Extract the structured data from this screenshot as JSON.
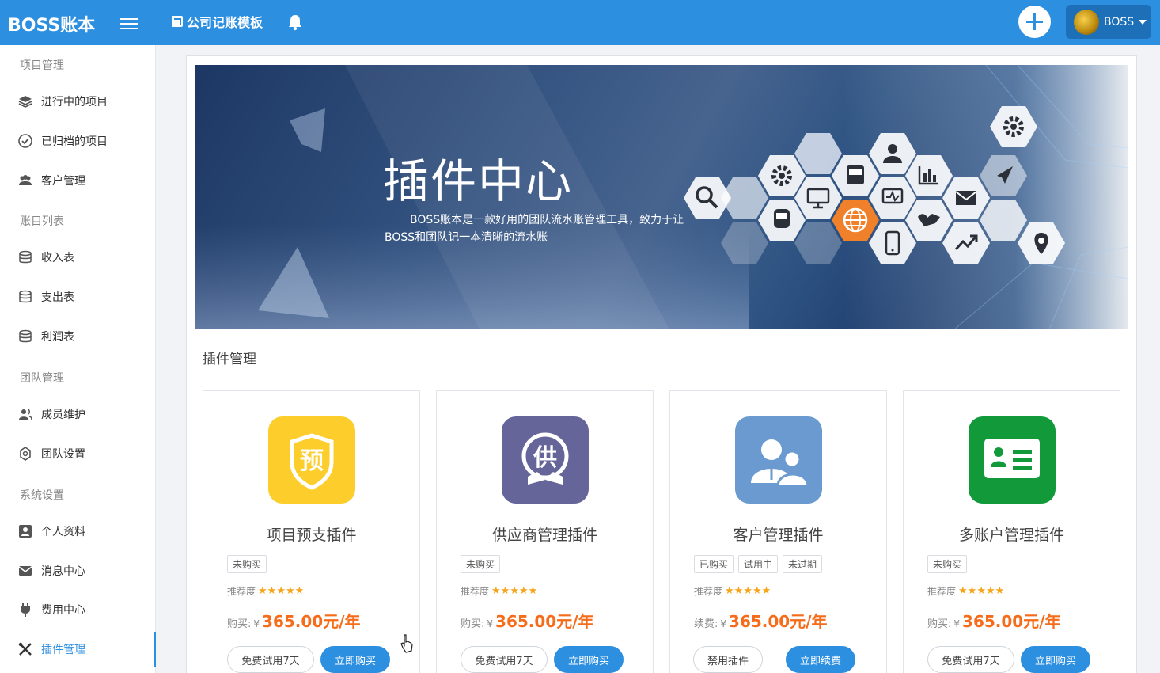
{
  "app": {
    "logo": "BOSS账本",
    "template_link": "公司记账模板",
    "user_name": "BOSS"
  },
  "sidebar": {
    "sections": [
      {
        "title": "项目管理",
        "items": [
          {
            "label": "进行中的项目",
            "icon": "layers-icon"
          },
          {
            "label": "已归档的项目",
            "icon": "check-circle-icon"
          },
          {
            "label": "客户管理",
            "icon": "users-icon"
          }
        ]
      },
      {
        "title": "账目列表",
        "items": [
          {
            "label": "收入表",
            "icon": "database-icon"
          },
          {
            "label": "支出表",
            "icon": "database-icon"
          },
          {
            "label": "利润表",
            "icon": "database-icon"
          }
        ]
      },
      {
        "title": "团队管理",
        "items": [
          {
            "label": "成员维护",
            "icon": "user-group-icon"
          },
          {
            "label": "团队设置",
            "icon": "gear-outline-icon"
          }
        ]
      },
      {
        "title": "系统设置",
        "items": [
          {
            "label": "个人资料",
            "icon": "profile-icon"
          },
          {
            "label": "消息中心",
            "icon": "mail-icon"
          },
          {
            "label": "费用中心",
            "icon": "plug-icon"
          },
          {
            "label": "插件管理",
            "icon": "tools-icon",
            "active": true
          }
        ]
      }
    ]
  },
  "banner": {
    "title": "插件中心",
    "desc": "BOSS账本是一款好用的团队流水账管理工具，致力于让BOSS和团队记一本清晰的流水账"
  },
  "plugins_section": {
    "title": "插件管理"
  },
  "plugins": [
    {
      "name": "项目预支插件",
      "icon_color": "#fdcd2c",
      "icon_glyph": "预",
      "tags": [
        "未购买"
      ],
      "rate_label": "推荐度",
      "stars": "★★★★★",
      "price_label": "购买:",
      "currency": "¥",
      "price": "365.00元/年",
      "btn_left": "免费试用7天",
      "btn_right": "立即购买"
    },
    {
      "name": "供应商管理插件",
      "icon_color": "#66659a",
      "icon_glyph": "供",
      "tags": [
        "未购买"
      ],
      "rate_label": "推荐度",
      "stars": "★★★★★",
      "price_label": "购买:",
      "currency": "¥",
      "price": "365.00元/年",
      "btn_left": "免费试用7天",
      "btn_right": "立即购买"
    },
    {
      "name": "客户管理插件",
      "icon_color": "#6a9ad0",
      "icon_glyph": "",
      "tags": [
        "已购买",
        "试用中",
        "未过期"
      ],
      "rate_label": "推荐度",
      "stars": "★★★★★",
      "price_label": "续费:",
      "currency": "¥",
      "price": "365.00元/年",
      "btn_left": "禁用插件",
      "btn_right": "立即续费"
    },
    {
      "name": "多账户管理插件",
      "icon_color": "#129a3a",
      "icon_glyph": "",
      "tags": [
        "未购买"
      ],
      "rate_label": "推荐度",
      "stars": "★★★★★",
      "price_label": "购买:",
      "currency": "¥",
      "price": "365.00元/年",
      "btn_left": "免费试用7天",
      "btn_right": "立即购买"
    }
  ]
}
